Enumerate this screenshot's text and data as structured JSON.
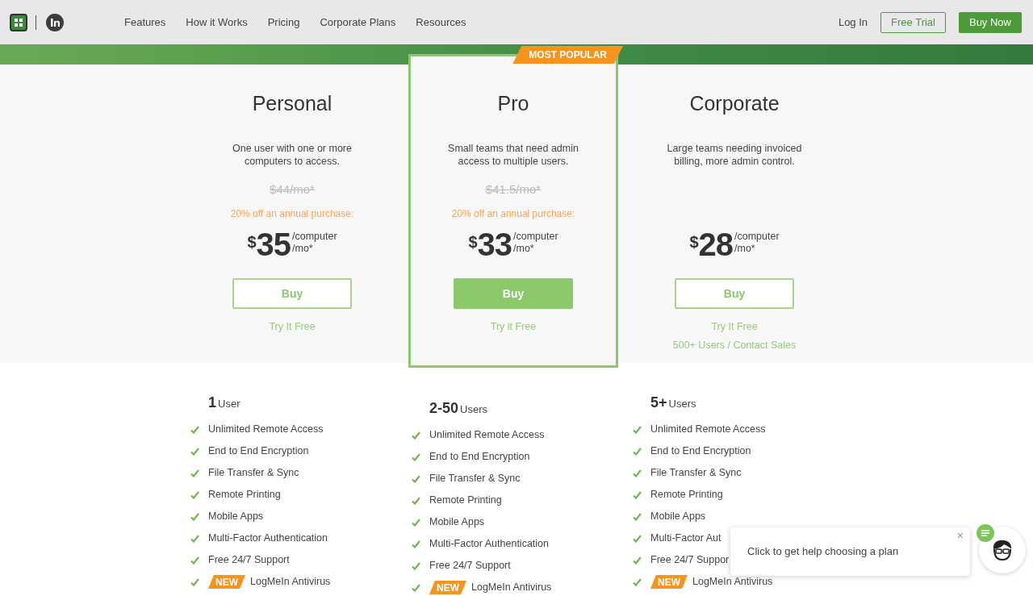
{
  "nav": {
    "links": [
      "Features",
      "How it Works",
      "Pricing",
      "Corporate Plans",
      "Resources"
    ],
    "login": "Log In",
    "free_trial": "Free Trial",
    "buy_now": "Buy Now"
  },
  "plans": [
    {
      "name": "Personal",
      "featured": false,
      "description": "One user with one or more computers to access.",
      "old_price": "$44/mo*",
      "discount_note": "20% off an annual purchase:",
      "currency": "$",
      "amount": "35",
      "unit": "/computer",
      "period": "/mo*",
      "buy": "Buy",
      "links": [
        "Try It Free"
      ],
      "users_count": "1",
      "users_label": "User",
      "features": [
        {
          "text": "Unlimited Remote Access",
          "new": false
        },
        {
          "text": "End to End Encryption",
          "new": false
        },
        {
          "text": "File Transfer & Sync",
          "new": false
        },
        {
          "text": "Remote Printing",
          "new": false
        },
        {
          "text": "Mobile Apps",
          "new": false
        },
        {
          "text": "Multi-Factor Authentication",
          "new": false
        },
        {
          "text": "Free 24/7 Support",
          "new": false
        },
        {
          "text": "LogMeIn Antivirus",
          "new": true,
          "badge": "NEW"
        }
      ]
    },
    {
      "name": "Pro",
      "featured": true,
      "badge": "MOST POPULAR",
      "description": "Small teams that need admin access to multiple users.",
      "old_price": "$41.5/mo*",
      "discount_note": "20% off an annual purchase:",
      "currency": "$",
      "amount": "33",
      "unit": "/computer",
      "period": "/mo*",
      "buy": "Buy",
      "links": [
        "Try it Free"
      ],
      "users_count": "2-50",
      "users_label": "Users",
      "features": [
        {
          "text": "Unlimited Remote Access",
          "new": false
        },
        {
          "text": "End to End Encryption",
          "new": false
        },
        {
          "text": "File Transfer & Sync",
          "new": false
        },
        {
          "text": "Remote Printing",
          "new": false
        },
        {
          "text": "Mobile Apps",
          "new": false
        },
        {
          "text": "Multi-Factor Authentication",
          "new": false
        },
        {
          "text": "Free 24/7 Support",
          "new": false
        },
        {
          "text": "LogMeIn Antivirus",
          "new": true,
          "badge": "NEW"
        }
      ]
    },
    {
      "name": "Corporate",
      "featured": false,
      "description": "Large teams needing invoiced billing, more admin control.",
      "currency": "$",
      "amount": "28",
      "unit": "/computer",
      "period": "/mo*",
      "buy": "Buy",
      "links": [
        "Try It Free",
        "500+ Users / Contact Sales"
      ],
      "users_count": "5+",
      "users_label": "Users",
      "features": [
        {
          "text": "Unlimited Remote Access",
          "new": false
        },
        {
          "text": "End to End Encryption",
          "new": false
        },
        {
          "text": "File Transfer & Sync",
          "new": false
        },
        {
          "text": "Remote Printing",
          "new": false
        },
        {
          "text": "Mobile Apps",
          "new": false
        },
        {
          "text": "Multi-Factor Aut",
          "new": false
        },
        {
          "text": "Free 24/7 Suppor",
          "new": false
        },
        {
          "text": "LogMeIn Antivirus",
          "new": true,
          "badge": "NEW"
        }
      ]
    }
  ],
  "chat": {
    "message": "Click to get help choosing a plan",
    "close": "×"
  }
}
